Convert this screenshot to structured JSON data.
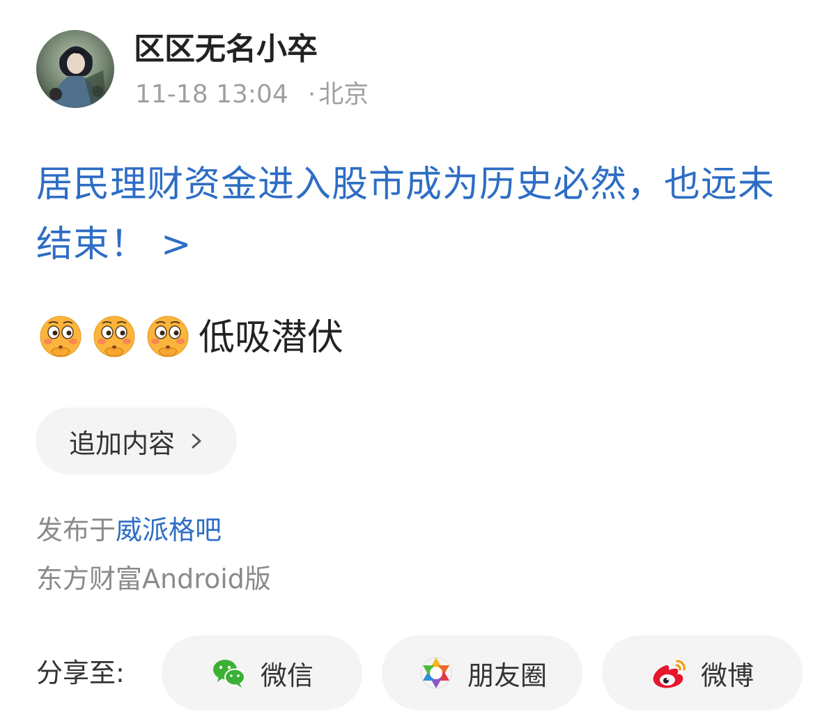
{
  "author": {
    "name": "区区无名小卒",
    "time": "11-18 13:04",
    "separator": "·",
    "location": "北京"
  },
  "post": {
    "title": "居民理财资金进入股市成为历史必然，也远未结束！",
    "title_arrow": ">",
    "emojis": [
      "flushed-face-emoji",
      "flushed-face-emoji",
      "flushed-face-emoji"
    ],
    "body": "低吸潜伏"
  },
  "actions": {
    "append_label": "追加内容"
  },
  "footer": {
    "published_prefix": "发布于",
    "forum_name": "威派格吧",
    "client": "东方财富Android版"
  },
  "share": {
    "label": "分享至:",
    "targets": [
      {
        "name": "微信",
        "icon": "wechat-icon"
      },
      {
        "name": "朋友圈",
        "icon": "moments-icon"
      },
      {
        "name": "微博",
        "icon": "weibo-icon"
      }
    ]
  },
  "colors": {
    "link": "#2d6dc4",
    "muted": "#8a8a8a",
    "pill_bg": "#f4f4f5"
  }
}
